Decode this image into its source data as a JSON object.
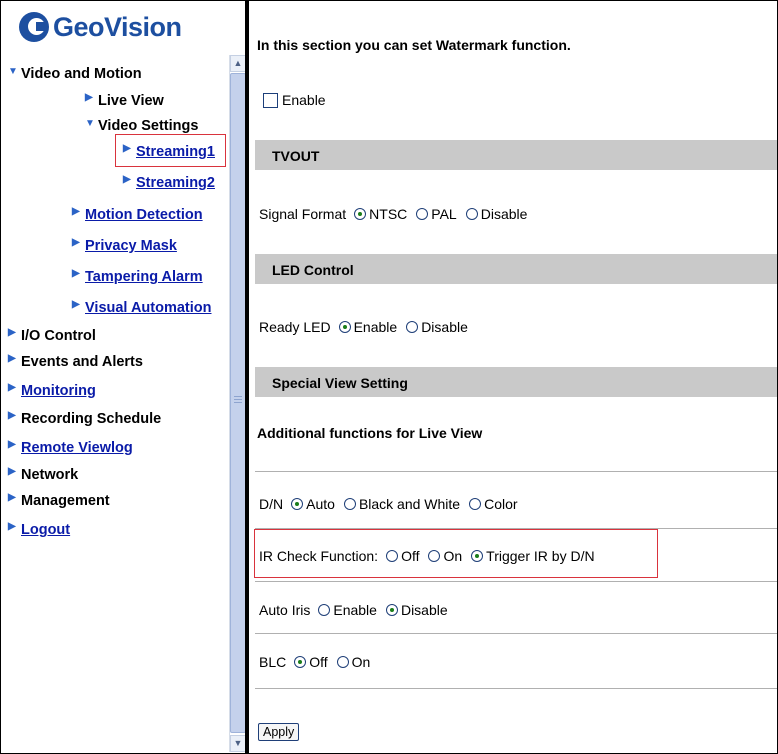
{
  "brand": {
    "logo_text": "GeoVision"
  },
  "nav": {
    "video_and_motion": "Video and Motion",
    "live_view": "Live View",
    "video_settings": "Video Settings",
    "streaming1": "Streaming1",
    "streaming2": "Streaming2",
    "motion_detection": "Motion Detection",
    "privacy_mask": "Privacy Mask",
    "tampering_alarm": "Tampering Alarm",
    "visual_automation": "Visual Automation",
    "io_control": "I/O Control",
    "events_and_alerts": "Events and Alerts",
    "monitoring": "Monitoring",
    "recording_schedule": "Recording Schedule",
    "remote_viewlog": "Remote Viewlog",
    "network": "Network",
    "management": "Management",
    "logout": "Logout"
  },
  "main": {
    "intro": "In this section you can set Watermark function.",
    "enable_label": "Enable",
    "tvout": {
      "header": "TVOUT",
      "label": "Signal Format",
      "options": [
        "NTSC",
        "PAL",
        "Disable"
      ],
      "selected": "NTSC"
    },
    "led": {
      "header": "LED Control",
      "label": "Ready LED",
      "options": [
        "Enable",
        "Disable"
      ],
      "selected": "Enable"
    },
    "special": {
      "header": "Special View Setting",
      "subheader": "Additional functions for Live View"
    },
    "dn": {
      "label": "D/N",
      "options": [
        "Auto",
        "Black and White",
        "Color"
      ],
      "selected": "Auto"
    },
    "ir": {
      "label": "IR Check Function:",
      "options": [
        "Off",
        "On",
        "Trigger IR by D/N"
      ],
      "selected": "Trigger IR by D/N"
    },
    "iris": {
      "label": "Auto Iris",
      "options": [
        "Enable",
        "Disable"
      ],
      "selected": "Disable"
    },
    "blc": {
      "label": "BLC",
      "options": [
        "Off",
        "On"
      ],
      "selected": "Off"
    },
    "apply_label": "Apply"
  },
  "colors": {
    "link": "#0a1ba8",
    "highlight": "#d9333d",
    "section_bg": "#c9c9c9",
    "logo": "#1d4fa0"
  }
}
